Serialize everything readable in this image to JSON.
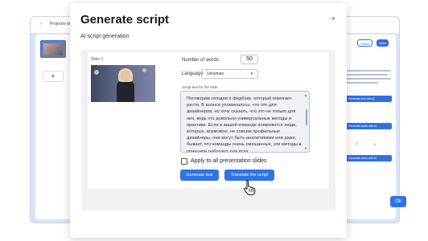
{
  "app": {
    "title": "Projector lectures",
    "back_icon": "chevron-left-icon",
    "add_slide_label": "+",
    "share_label": "Share",
    "save_label": "Save",
    "right_panel_items": [
      "Generate text with AI",
      "Generate audio with AI",
      "Generate video with AI"
    ]
  },
  "modal": {
    "title": "Generate script",
    "subtitle": "AI script generation",
    "close_icon": "close-icon",
    "slide_label": "Slide 1",
    "words_label": "Number of words:",
    "words_value": "50",
    "language_label": "Language",
    "language_value": "Ukrainian",
    "script_label": "Script text for the slide",
    "script_text": "Поговорим сегодня о фидбэке, который помогает расти. В анонсе упоминалось, что это для дизайнеров, но хочу сказать, что это не только для них, ведь это довольно универсальные методы и практики. Если в вашей команде появляются люди, которые, возможно, не совсем профильные дизайнеры, они могут быть аналитиками или даже, бывает, что команды очень смешанные, эти методы в принципе работают для всех.",
    "apply_all_label": "Apply to all presentation slides",
    "apply_all_checked": false,
    "generate_button": "Generate text",
    "translate_button": "Translate the script",
    "ok_button": "Ok"
  },
  "colors": {
    "accent": "#2f74e6",
    "backdrop": "#d9e5f7"
  }
}
